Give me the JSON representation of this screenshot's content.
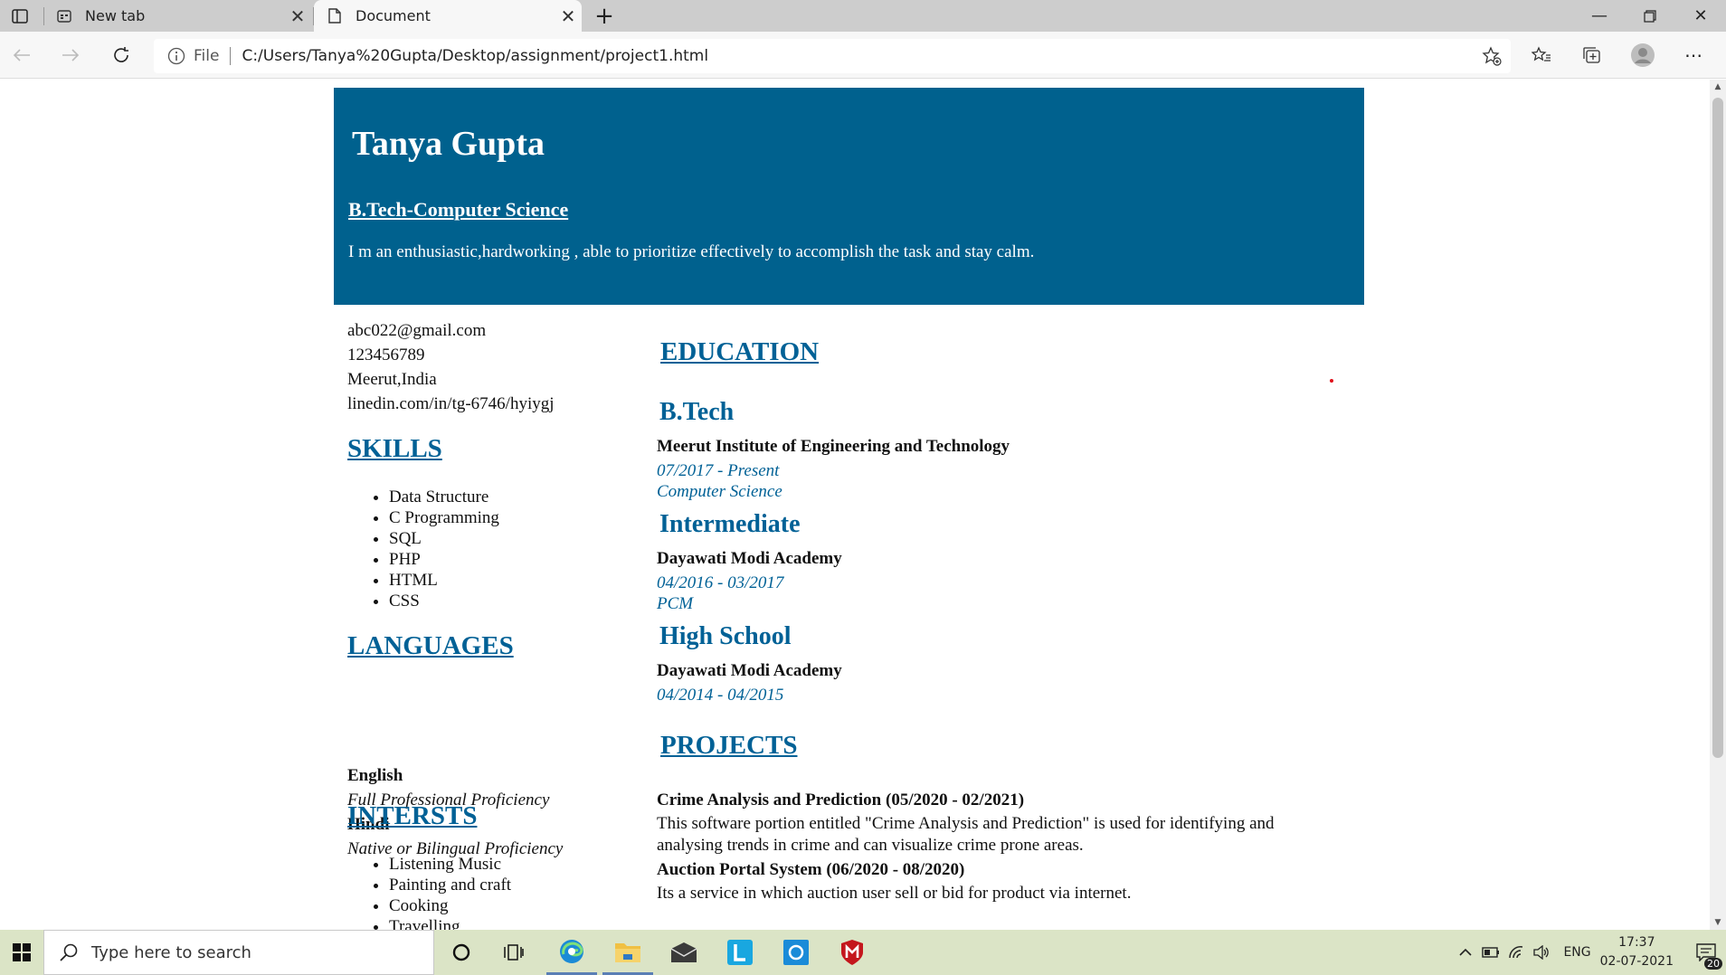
{
  "browser": {
    "tabs": [
      {
        "title": "New tab",
        "icon": "new-tab-icon"
      },
      {
        "title": "Document",
        "icon": "document-icon"
      }
    ],
    "address": {
      "scheme_label": "File",
      "url": "C:/Users/Tanya%20Gupta/Desktop/assignment/project1.html"
    }
  },
  "resume": {
    "name": "Tanya Gupta",
    "degree": " B.Tech-Computer Science",
    "summary": "I m an enthusiastic,hardworking , able to prioritize effectively to accomplish the task and stay calm.",
    "contact": {
      "email": "abc022@gmail.com",
      "phone": "123456789",
      "location": "Meerut,India",
      "linkedin": "linedin.com/in/tg-6746/hyiygj"
    },
    "skills_heading": "SKILLS",
    "skills": [
      "Data Structure",
      "C Programming",
      "SQL",
      "PHP",
      "HTML",
      "CSS"
    ],
    "languages_heading": "LANGUAGES",
    "languages": [
      {
        "name": "English",
        "level": "Full Professional Proficiency"
      },
      {
        "name": "Hindi",
        "level": "Native or Bilingual Proficiency"
      }
    ],
    "interests_heading": "INTERSTS",
    "interests": [
      "Listening Music",
      "Painting and craft",
      "Cooking",
      "Travelling"
    ],
    "education_heading": "EDUCATION",
    "education": [
      {
        "degree": "B.Tech",
        "institute": "Meerut Institute of Engineering and Technology",
        "dates": "07/2017 - Present",
        "field": "Computer Science"
      },
      {
        "degree": "Intermediate",
        "institute": "Dayawati Modi Academy",
        "dates": "04/2016 - 03/2017",
        "field": "PCM"
      },
      {
        "degree": "High School",
        "institute": "Dayawati Modi Academy",
        "dates": "04/2014 - 04/2015",
        "field": ""
      }
    ],
    "projects_heading": "PROJECTS",
    "projects": [
      {
        "title": "Crime Analysis and Prediction (05/2020 - 02/2021)",
        "desc": "This software portion entitled \"Crime Analysis and Prediction\" is used for identifying and analysing trends in crime and can visualize crime prone areas."
      },
      {
        "title": "Auction Portal System (06/2020 - 08/2020)",
        "desc": "Its a service in which auction user sell or bid for product via internet."
      }
    ]
  },
  "taskbar": {
    "search_placeholder": "Type here to search",
    "language": "ENG",
    "time": "17:37",
    "date": "02-07-2021",
    "notification_count": "20"
  },
  "colors": {
    "header_bg": "#00618e",
    "accent": "#006196",
    "taskbar": "#dbe4c6"
  }
}
